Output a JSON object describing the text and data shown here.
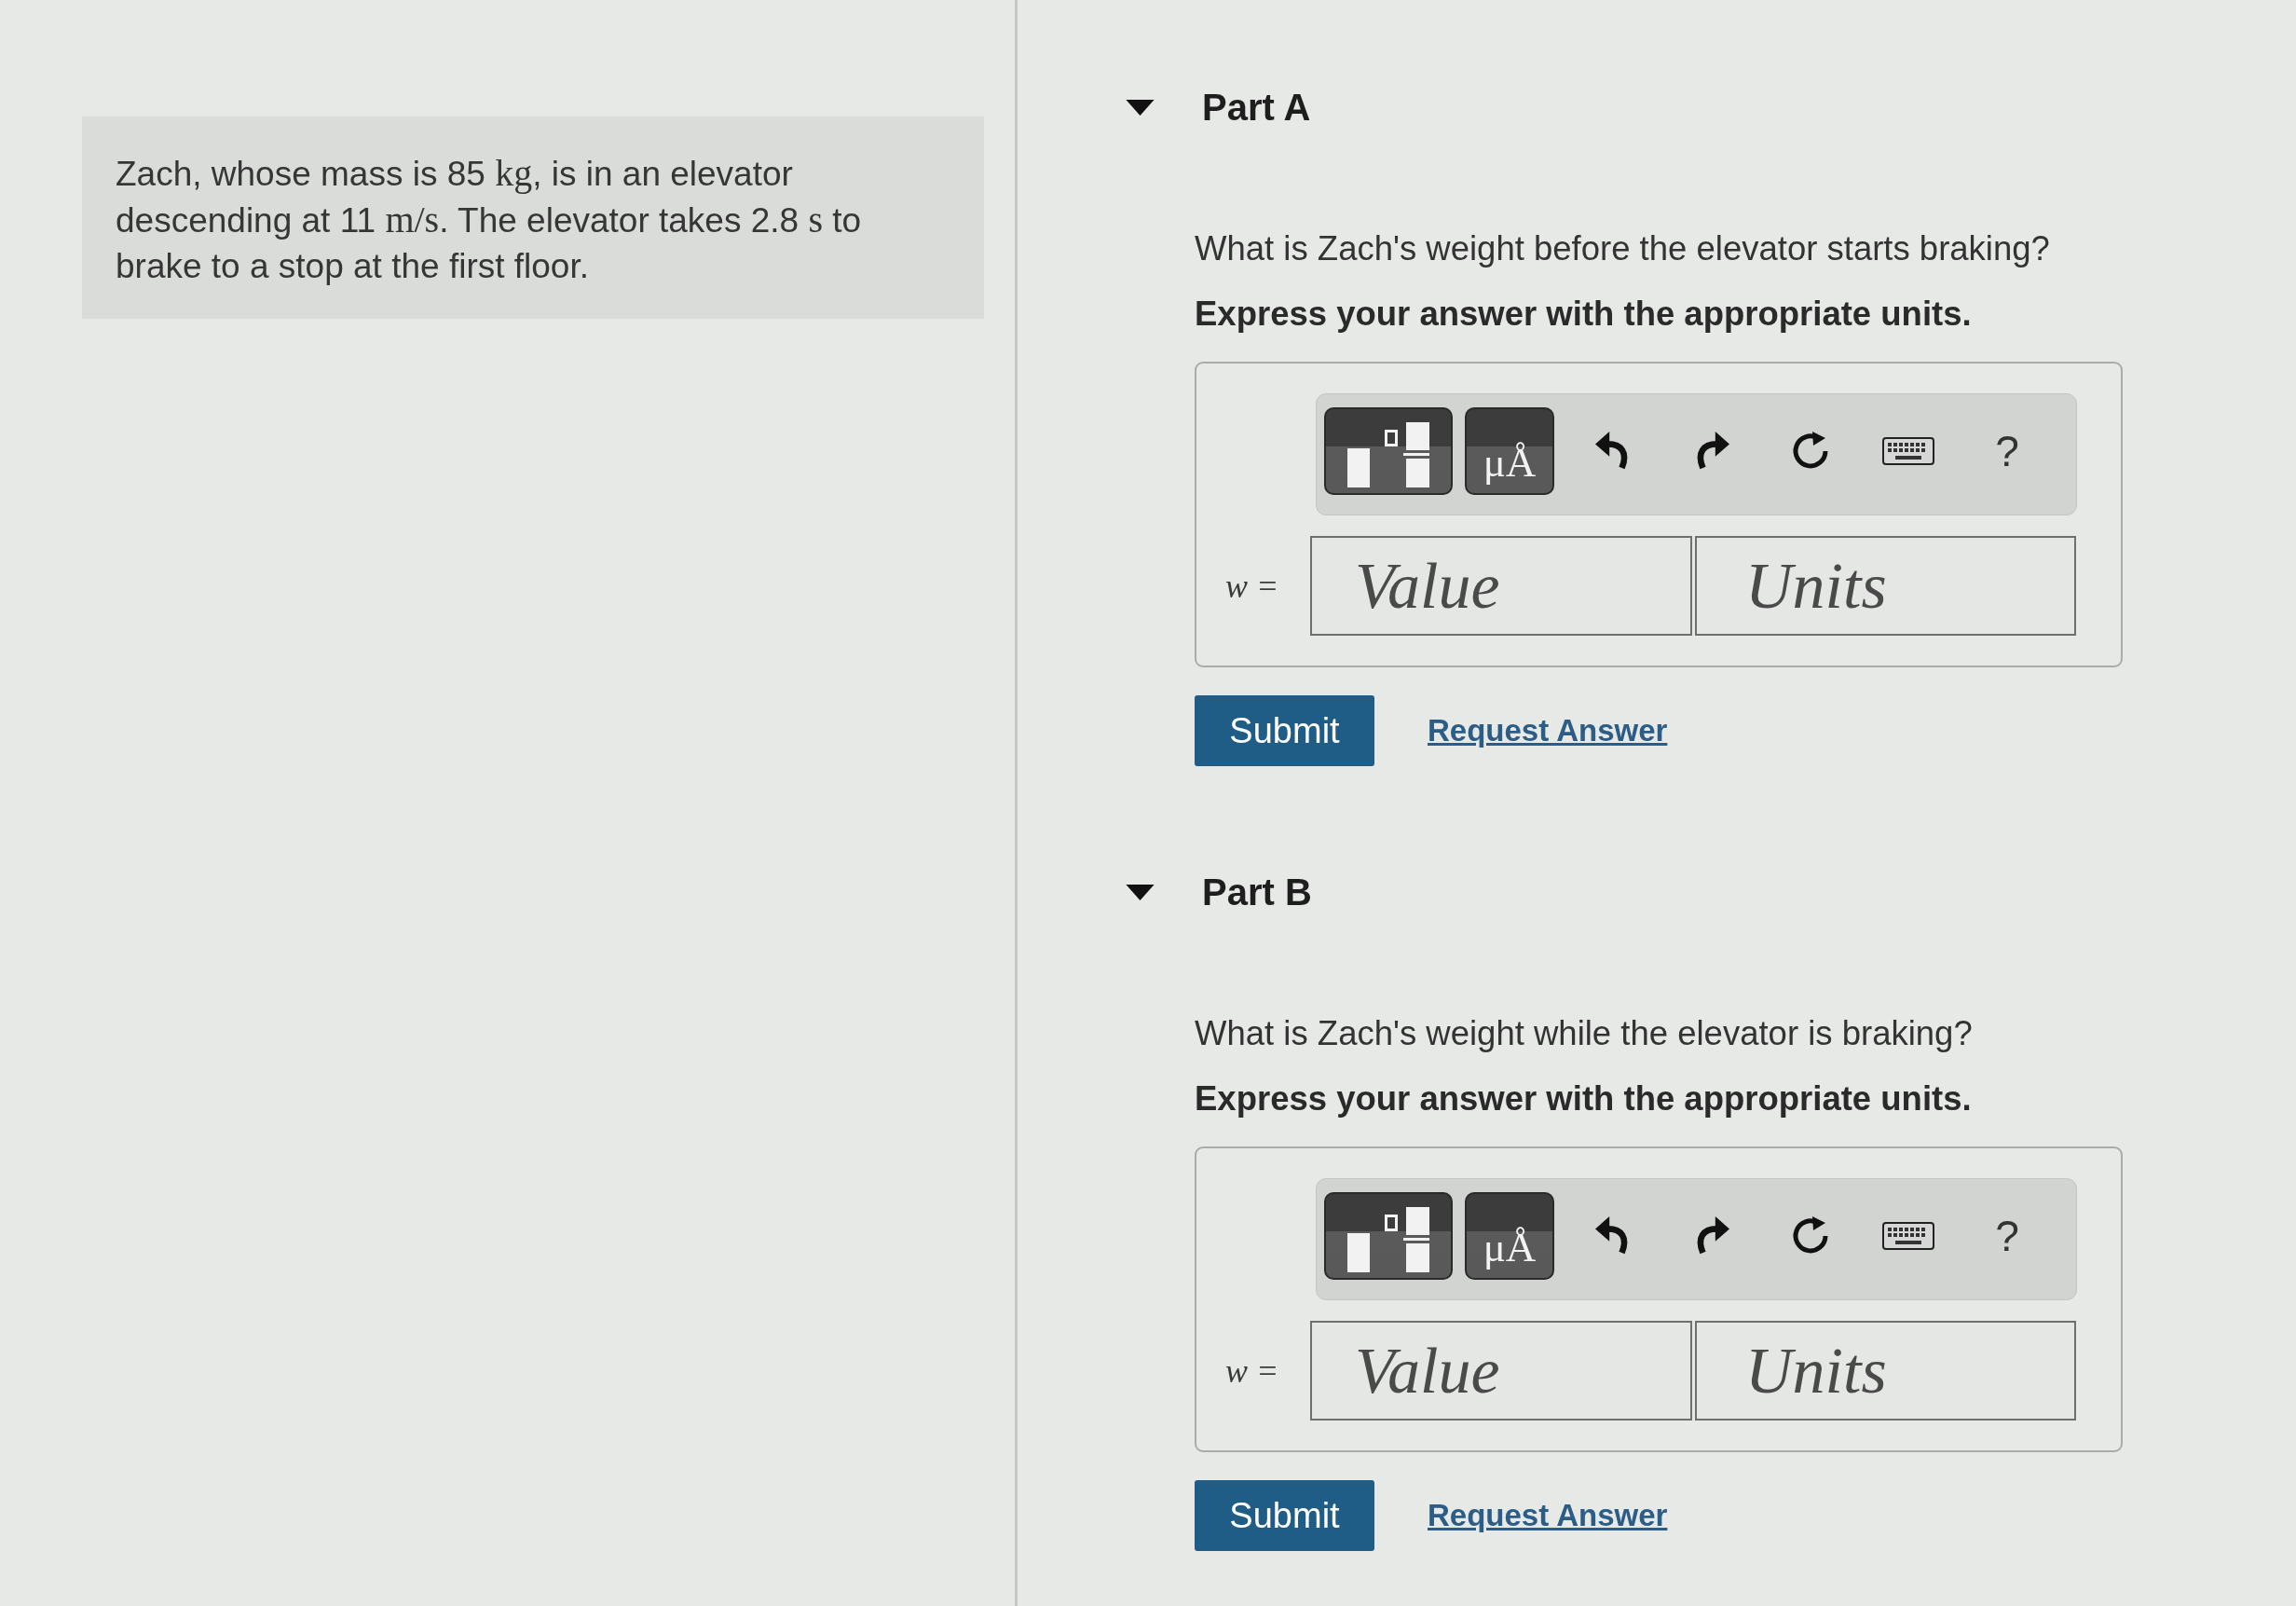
{
  "problem": {
    "segments": [
      {
        "kind": "text",
        "text": "Zach, whose mass is 85 "
      },
      {
        "kind": "math",
        "text": "kg"
      },
      {
        "kind": "text",
        "text": ", is in an elevator descending at 11 "
      },
      {
        "kind": "math",
        "text": "m/s"
      },
      {
        "kind": "text",
        "text": ". The elevator takes 2.8 "
      },
      {
        "kind": "math",
        "text": "s"
      },
      {
        "kind": "text",
        "text": " to brake to a stop at the first floor."
      }
    ]
  },
  "parts": [
    {
      "title": "Part A",
      "expanded": true,
      "question": "What is Zach's weight before the elevator starts braking?",
      "instruction": "Express your answer with the appropriate units.",
      "toolbar": [
        {
          "kind": "templates"
        },
        {
          "kind": "symbols",
          "label": "μÅ"
        },
        {
          "kind": "undo"
        },
        {
          "kind": "redo"
        },
        {
          "kind": "reset"
        },
        {
          "kind": "keyboard"
        },
        {
          "kind": "help",
          "label": "?"
        }
      ],
      "answer": {
        "label": "w =",
        "fields": [
          {
            "kind": "value",
            "placeholder": "Value"
          },
          {
            "kind": "units",
            "placeholder": "Units"
          }
        ]
      },
      "submit": "Submit",
      "request_answer": "Request Answer"
    },
    {
      "title": "Part B",
      "expanded": true,
      "question": "What is Zach's weight while the elevator is braking?",
      "instruction": "Express your answer with the appropriate units.",
      "toolbar": [
        {
          "kind": "templates"
        },
        {
          "kind": "symbols",
          "label": "μÅ"
        },
        {
          "kind": "undo"
        },
        {
          "kind": "redo"
        },
        {
          "kind": "reset"
        },
        {
          "kind": "keyboard"
        },
        {
          "kind": "help",
          "label": "?"
        }
      ],
      "answer": {
        "label": "w =",
        "fields": [
          {
            "kind": "value",
            "placeholder": "Value"
          },
          {
            "kind": "units",
            "placeholder": "Units"
          }
        ]
      },
      "submit": "Submit",
      "request_answer": "Request Answer"
    }
  ]
}
